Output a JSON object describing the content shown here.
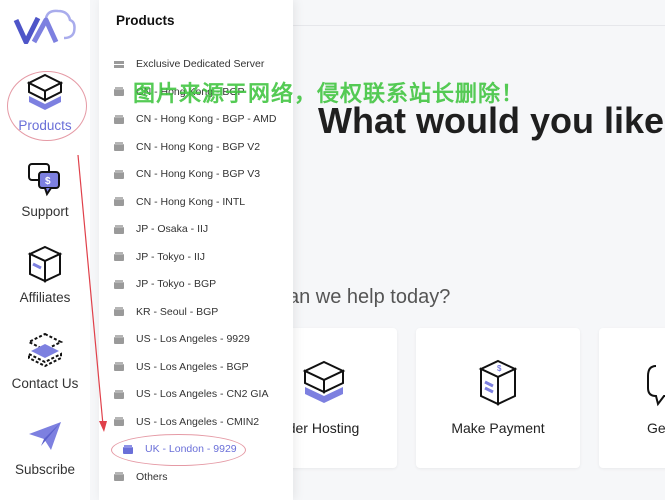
{
  "sidebar": {
    "items": [
      {
        "label": "Products",
        "icon": "box-icon"
      },
      {
        "label": "Support",
        "icon": "chat-icon"
      },
      {
        "label": "Affiliates",
        "icon": "package-icon"
      },
      {
        "label": "Contact Us",
        "icon": "layers-icon"
      },
      {
        "label": "Subscribe",
        "icon": "paper-plane-icon"
      }
    ]
  },
  "dropdown": {
    "title": "Products",
    "items": [
      "Exclusive Dedicated Server",
      "CN - Hong Kong - BGP",
      "CN - Hong Kong - BGP - AMD",
      "CN - Hong Kong - BGP V2",
      "CN - Hong Kong - BGP V3",
      "CN - Hong Kong - INTL",
      "JP - Osaka - IIJ",
      "JP - Tokyo - IIJ",
      "JP - Tokyo - BGP",
      "KR - Seoul - BGP",
      "US - Los Angeles - 9929",
      "US - Los Angeles - BGP",
      "US - Los Angeles - CN2 GIA",
      "US - Los Angeles - CMIN2",
      "UK - London - 9929",
      "Others"
    ],
    "active_index": 14
  },
  "main": {
    "headline": "What would you like t",
    "subline": "an we help today?",
    "cards": [
      {
        "label": "der Hosting",
        "icon": "server-icon"
      },
      {
        "label": "Make Payment",
        "icon": "dollar-box-icon"
      },
      {
        "label": "Get",
        "icon": "chat-bubble-icon"
      }
    ]
  },
  "watermark": "图片来源于网络，侵权联系站长删除！",
  "colors": {
    "accent": "#6a6fd8",
    "annotation": "#e0404a",
    "watermark": "#3ec43e"
  }
}
